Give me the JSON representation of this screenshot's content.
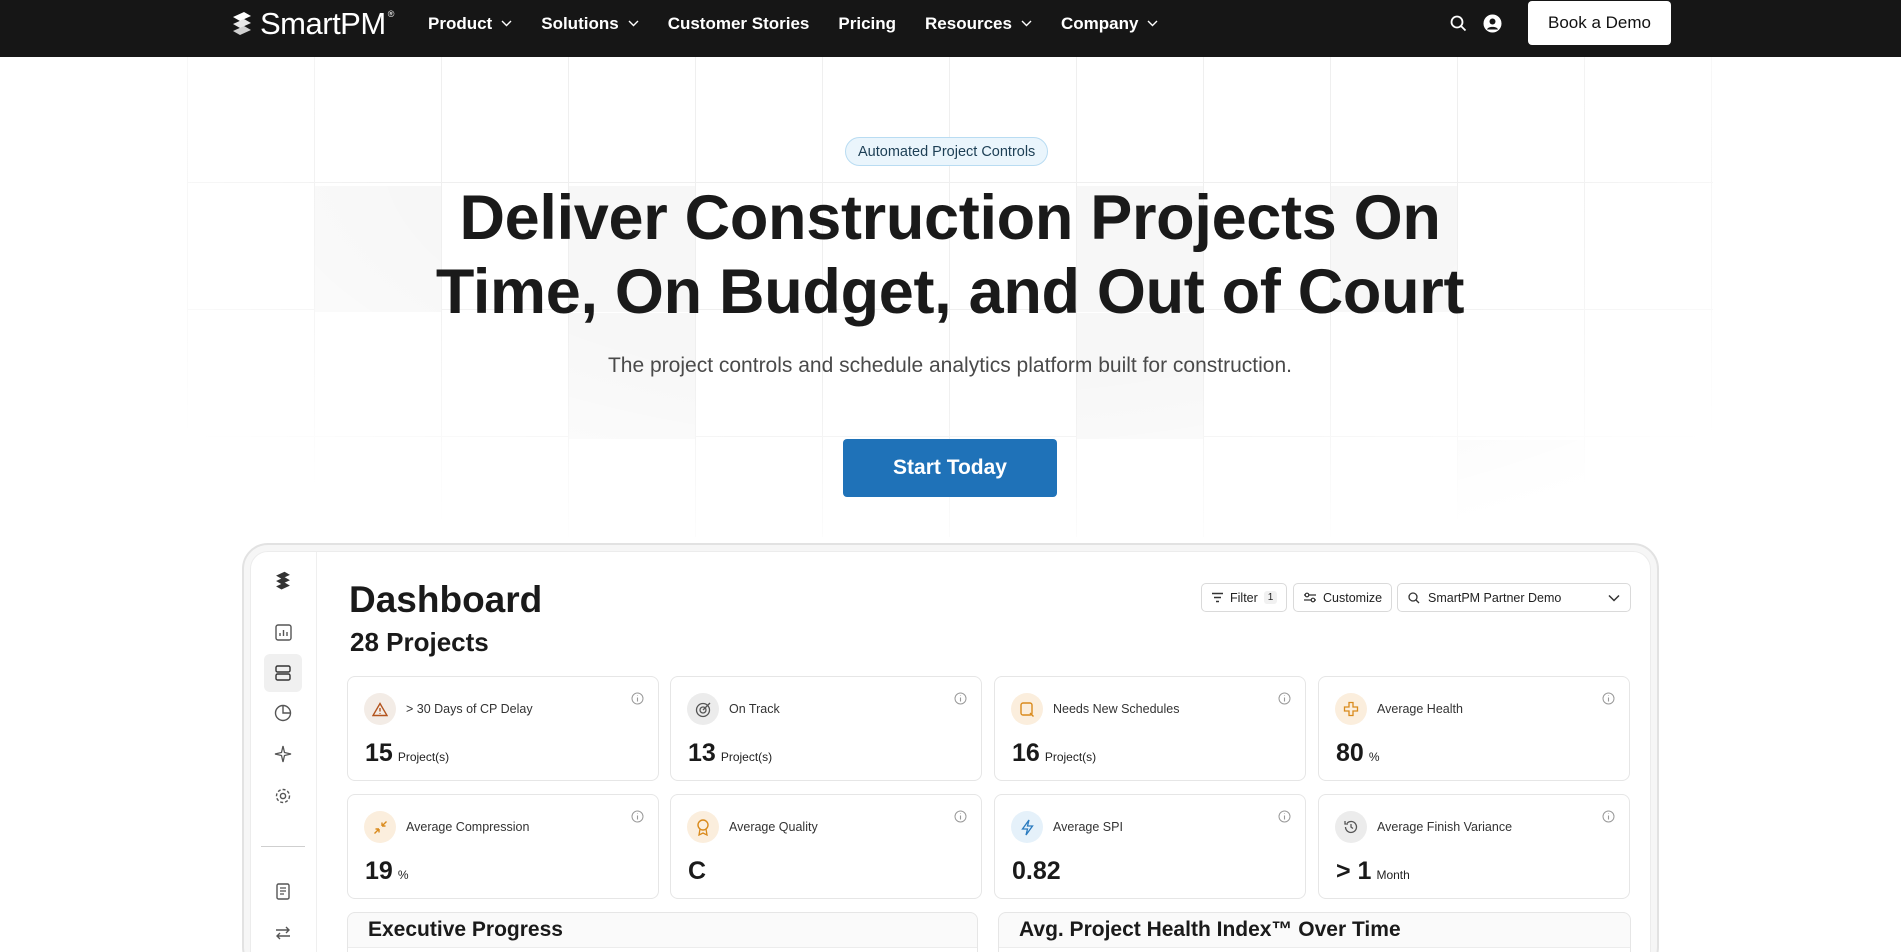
{
  "nav": {
    "brand": "SmartPM",
    "brand_mark": "®",
    "items": [
      {
        "label": "Product",
        "dropdown": true
      },
      {
        "label": "Solutions",
        "dropdown": true
      },
      {
        "label": "Customer Stories",
        "dropdown": false
      },
      {
        "label": "Pricing",
        "dropdown": false
      },
      {
        "label": "Resources",
        "dropdown": true
      },
      {
        "label": "Company",
        "dropdown": true
      }
    ],
    "demo_label": "Book a Demo",
    "icons": [
      "search-icon",
      "account-icon"
    ]
  },
  "hero": {
    "badge": "Automated Project Controls",
    "headline_line1": "Deliver Construction Projects On",
    "headline_line2": "Time, On Budget, and Out of Court",
    "subheadline": "The project controls and schedule analytics platform built for construction.",
    "cta_label": "Start Today"
  },
  "dashboard": {
    "title": "Dashboard",
    "project_count": "28 Projects",
    "filter_label": "Filter",
    "filter_count": "1",
    "customize_label": "Customize",
    "project_select": "SmartPM Partner Demo",
    "cards": [
      {
        "label": "> 30 Days of CP Delay",
        "value": "15",
        "unit": "Project(s)",
        "icon": "warning-icon"
      },
      {
        "label": "On Track",
        "value": "13",
        "unit": "Project(s)",
        "icon": "target-icon"
      },
      {
        "label": "Needs New Schedules",
        "value": "16",
        "unit": "Project(s)",
        "icon": "schedule-icon"
      },
      {
        "label": "Average Health",
        "value": "80",
        "unit": "%",
        "icon": "health-plus-icon"
      },
      {
        "label": "Average Compression",
        "value": "19",
        "unit": "%",
        "icon": "compress-icon"
      },
      {
        "label": "Average Quality",
        "value": "C",
        "unit": "",
        "icon": "award-icon"
      },
      {
        "label": "Average SPI",
        "value": "0.82",
        "unit": "",
        "icon": "bolt-icon"
      },
      {
        "label": "Average Finish Variance",
        "value": "> 1",
        "unit": "Month",
        "icon": "history-icon"
      }
    ],
    "panels": [
      {
        "title": "Executive Progress"
      },
      {
        "title": "Avg. Project Health Index™ Over Time"
      }
    ]
  },
  "colors": {
    "nav_bg": "#161616",
    "cta_bg": "#1f72b8",
    "badge_bg": "#eaf5fc",
    "badge_border": "#b9dcf2"
  }
}
